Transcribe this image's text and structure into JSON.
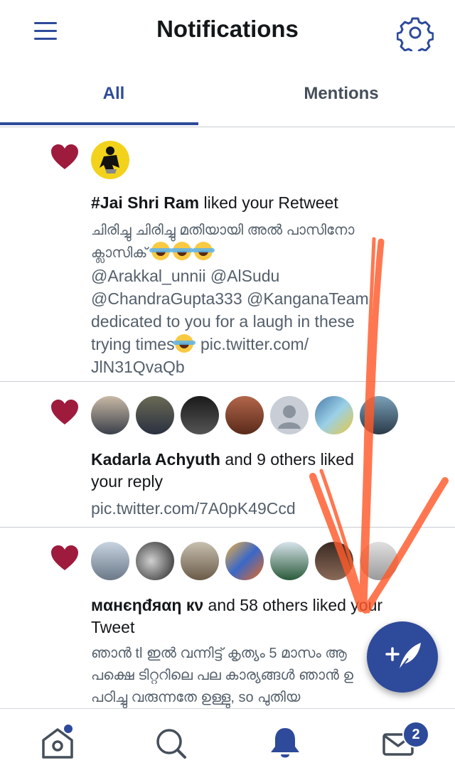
{
  "header": {
    "title": "Notifications",
    "menu_icon": "hamburger-menu-icon",
    "settings_icon": "gear-icon",
    "accent_color": "#2e4a9a"
  },
  "tabs": [
    {
      "label": "All",
      "active": true
    },
    {
      "label": "Mentions",
      "active": false
    }
  ],
  "notifications": [
    {
      "actor": "#Jai Shri Ram",
      "action": "liked your Retweet",
      "body_line1": "ചിരിച്ചു ചിരിച്ചു മതിയായി അൽ പാസിനോ",
      "body_line2": "ക്ലാസിക്",
      "body_line3": "@Arakkal_unnii @AlSudu",
      "body_line4": "@ChandraGupta333 @KanganaTeam",
      "body_line5": "dedicated to you for a laugh in these",
      "body_line6": "trying times",
      "body_line6_link": "pic.twitter.com/",
      "body_line7": "JlN31QvaQb"
    },
    {
      "actor": "Kadarla Achyuth",
      "action": "and 9 others liked",
      "action_line2": "your reply",
      "link": "pic.twitter.com/7A0pK49Ccd"
    },
    {
      "actor": "мαнєηđяαη кν",
      "action": "and 58 others liked your",
      "action_line2": "Tweet",
      "body_line1": "ഞാൻ tl ഇൽ വന്നിട്ട് കൃത്യം 5 മാസം ആ",
      "body_line2": "പക്ഷെ ടിറ്ററിലെ പല കാര്യങ്ങൾ ഞാൻ ഉ",
      "body_line3": "പഠിച്ചു വരുന്നതേ ഉള്ളു, so പുതിയ"
    }
  ],
  "bottom_nav": [
    {
      "icon": "home-icon",
      "has_dot": true
    },
    {
      "icon": "search-icon"
    },
    {
      "icon": "bell-icon",
      "active": true
    },
    {
      "icon": "mail-icon",
      "badge": "2"
    }
  ],
  "fab": {
    "icon": "compose-tweet-icon"
  },
  "colors": {
    "heart": "#9e1b3d",
    "annotation_arrow": "#ff5a2a",
    "muted_text": "#545f6b"
  }
}
